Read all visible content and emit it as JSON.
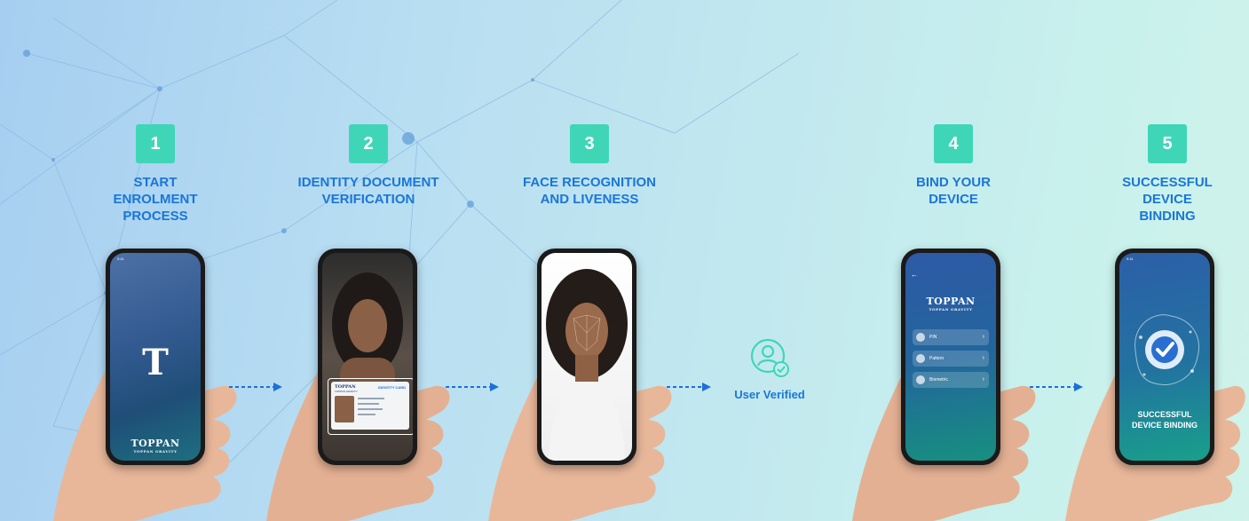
{
  "steps": [
    {
      "number": "1",
      "label": "START\nENROLMENT\nPROCESS"
    },
    {
      "number": "2",
      "label": "IDENTITY DOCUMENT\nVERIFICATION"
    },
    {
      "number": "3",
      "label": "FACE RECOGNITION\nAND LIVENESS"
    },
    {
      "number": "4",
      "label": "BIND YOUR\nDEVICE"
    },
    {
      "number": "5",
      "label": "SUCCESSFUL\nDEVICE\nBINDING"
    }
  ],
  "verified": {
    "label": "User Verified",
    "icon": "user-verified-icon"
  },
  "brand": {
    "name": "TOPPAN",
    "subtitle": "TOPPAN GRAVITY",
    "logo_letter": "T"
  },
  "id_card": {
    "brand": "TOPPAN",
    "sub": "TOPPAN GRAVITY",
    "title": "IDENTITY CARD"
  },
  "bind_menu": [
    {
      "label": "PIN",
      "icon": "pin-icon"
    },
    {
      "label": "Pattern",
      "icon": "pattern-icon"
    },
    {
      "label": "Biometric",
      "icon": "biometric-icon"
    }
  ],
  "success_screen": {
    "text": "SUCCESSFUL\nDEVICE BINDING"
  },
  "status_bar": {
    "time": "9:41"
  },
  "colors": {
    "accent_teal": "#3fd6b8",
    "label_blue": "#1a76d8",
    "arrow_blue": "#1e6fd9"
  }
}
